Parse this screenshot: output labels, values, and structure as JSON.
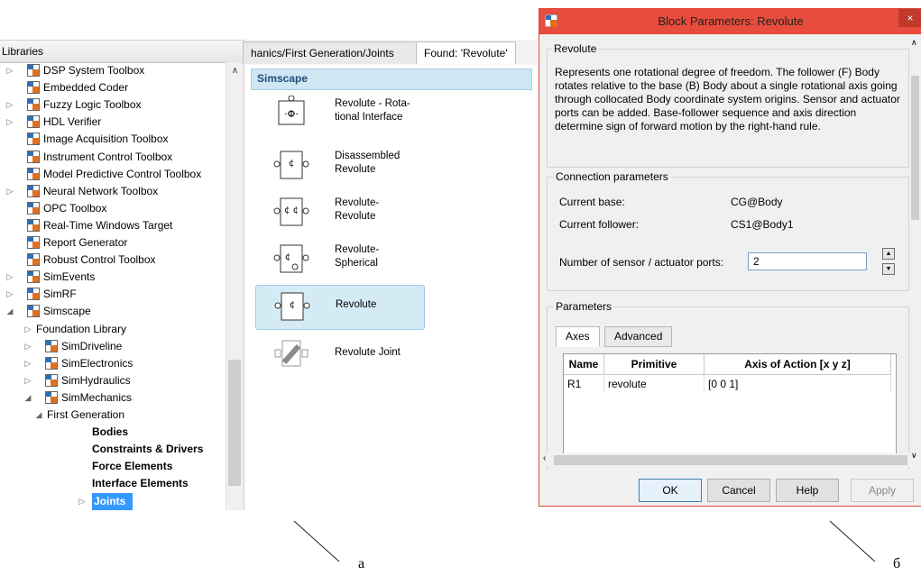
{
  "library_panel": {
    "header": "Libraries",
    "items": [
      {
        "label": "DSP System Toolbox",
        "expander": "▷",
        "icon": true
      },
      {
        "label": "Embedded Coder",
        "expander": "",
        "icon": true
      },
      {
        "label": "Fuzzy Logic Toolbox",
        "expander": "▷",
        "icon": true
      },
      {
        "label": "HDL Verifier",
        "expander": "▷",
        "icon": true
      },
      {
        "label": "Image Acquisition Toolbox",
        "expander": "",
        "icon": true
      },
      {
        "label": "Instrument Control Toolbox",
        "expander": "",
        "icon": true
      },
      {
        "label": "Model Predictive Control Toolbox",
        "expander": "",
        "icon": true
      },
      {
        "label": "Neural Network Toolbox",
        "expander": "▷",
        "icon": true
      },
      {
        "label": "OPC Toolbox",
        "expander": "",
        "icon": true
      },
      {
        "label": "Real-Time Windows Target",
        "expander": "",
        "icon": true
      },
      {
        "label": "Report Generator",
        "expander": "",
        "icon": true
      },
      {
        "label": "Robust Control Toolbox",
        "expander": "",
        "icon": true
      },
      {
        "label": "SimEvents",
        "expander": "▷",
        "icon": true
      },
      {
        "label": "SimRF",
        "expander": "▷",
        "icon": true
      },
      {
        "label": "Simscape",
        "expander": "◢",
        "icon": true
      },
      {
        "label": "Foundation Library",
        "expander": "▷",
        "icon": false
      },
      {
        "label": "SimDriveline",
        "expander": "▷",
        "icon": true
      },
      {
        "label": "SimElectronics",
        "expander": "▷",
        "icon": true
      },
      {
        "label": "SimHydraulics",
        "expander": "▷",
        "icon": true
      },
      {
        "label": "SimMechanics",
        "expander": "◢",
        "icon": true
      },
      {
        "label": "First Generation",
        "expander": "◢",
        "icon": false
      },
      {
        "label": "Bodies",
        "expander": "",
        "icon": false
      },
      {
        "label": "Constraints & Drivers",
        "expander": "",
        "icon": false
      },
      {
        "label": "Force Elements",
        "expander": "",
        "icon": false
      },
      {
        "label": "Interface Elements",
        "expander": "",
        "icon": false
      },
      {
        "label": "Joints",
        "expander": "▷",
        "icon": false,
        "selected": true
      }
    ]
  },
  "block_panel": {
    "tabs": [
      "hanics/First Generation/Joints",
      "Found: 'Revolute'"
    ],
    "section_header": "Simscape",
    "blocks": [
      {
        "label": "Revolute - Rota-\ntional Interface",
        "icon": "revolute-rotational-interface-icon"
      },
      {
        "label": "Disassembled\nRevolute",
        "icon": "disassembled-revolute-icon"
      },
      {
        "label": "Revolute-\nRevolute",
        "icon": "revolute-revolute-icon"
      },
      {
        "label": "Revolute-\nSpherical",
        "icon": "revolute-spherical-icon"
      },
      {
        "label": "Revolute",
        "icon": "revolute-icon",
        "selected": true
      },
      {
        "label": "Revolute Joint",
        "icon": "revolute-joint-icon"
      }
    ]
  },
  "dialog": {
    "title": "Block Parameters: Revolute",
    "close_label": "×",
    "group_title": "Revolute",
    "description": "Represents one rotational degree of freedom. The follower (F) Body rotates relative to the base (B) Body about a single rotational axis going through collocated Body coordinate system origins. Sensor and actuator ports can be added. Base-follower sequence and axis direction determine sign of forward motion by the right-hand rule.",
    "connection": {
      "title": "Connection parameters",
      "base_label": "Current base:",
      "base_value": "CG@Body",
      "follower_label": "Current follower:",
      "follower_value": "CS1@Body1",
      "ports_label": "Number of sensor / actuator ports:",
      "ports_value": "2"
    },
    "parameters": {
      "title": "Parameters",
      "tabs": [
        "Axes",
        "Advanced"
      ],
      "columns": [
        "Name",
        "Primitive",
        "Axis of Action [x y z]"
      ],
      "rows": [
        {
          "name": "R1",
          "primitive": "revolute",
          "axis": "[0 0 1]"
        }
      ]
    },
    "buttons": {
      "ok": "OK",
      "cancel": "Cancel",
      "help": "Help",
      "apply": "Apply"
    }
  },
  "captions": {
    "left": "а",
    "right": "б"
  },
  "colors": {
    "title_bar": "#e74c3c",
    "selection": "#3399ff",
    "simscape_header": "#cfe6f3"
  }
}
